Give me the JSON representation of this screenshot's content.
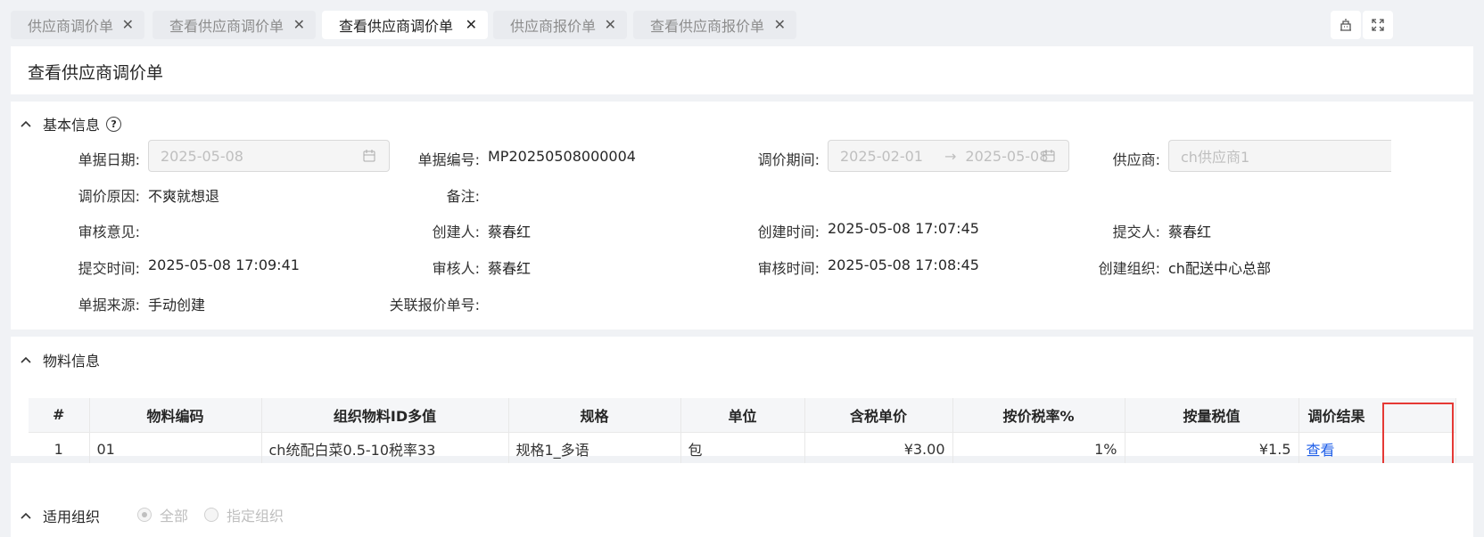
{
  "tabs": [
    {
      "label": "供应商调价单",
      "active": false
    },
    {
      "label": "查看供应商调价单",
      "active": false
    },
    {
      "label": "查看供应商调价单",
      "active": true
    },
    {
      "label": "供应商报价单",
      "active": false
    },
    {
      "label": "查看供应商报价单",
      "active": false
    }
  ],
  "close_glyph": "✕",
  "toolbar_icons": [
    "building-icon",
    "fullscreen-icon"
  ],
  "page_title": "查看供应商调价单",
  "basic": {
    "section_title": "基本信息",
    "doc_date_label": "单据日期:",
    "doc_date_value": "2025-05-08",
    "doc_no_label": "单据编号:",
    "doc_no_value": "MP20250508000004",
    "period_label": "调价期间:",
    "period_start": "2025-02-01",
    "period_end": "2025-05-08",
    "period_arrow": "→",
    "supplier_label": "供应商:",
    "supplier_value": "ch供应商1",
    "reason_label": "调价原因:",
    "reason_value": "不爽就想退",
    "remark_label": "备注:",
    "audit_opinion_label": "审核意见:",
    "creator_label": "创建人:",
    "creator_value": "蔡春红",
    "create_time_label": "创建时间:",
    "create_time_value": "2025-05-08 17:07:45",
    "submitter_label": "提交人:",
    "submitter_value": "蔡春红",
    "submit_time_label": "提交时间:",
    "submit_time_value": "2025-05-08 17:09:41",
    "auditor_label": "审核人:",
    "auditor_value": "蔡春红",
    "audit_time_label": "审核时间:",
    "audit_time_value": "2025-05-08 17:08:45",
    "create_org_label": "创建组织:",
    "create_org_value": "ch配送中心总部",
    "source_label": "单据来源:",
    "source_value": "手动创建",
    "related_quote_label": "关联报价单号:"
  },
  "materials": {
    "section_title": "物料信息",
    "columns": [
      "#",
      "物料编码",
      "组织物料ID多值",
      "规格",
      "单位",
      "含税单价",
      "按价税率%",
      "按量税值",
      "调价结果"
    ],
    "rows": [
      {
        "idx": "1",
        "code": "01",
        "org_material": "ch统配白菜0.5-10税率33",
        "spec": "规格1_多语",
        "unit": "包",
        "price": "¥3.00",
        "rate": "1%",
        "tax": "¥1.5",
        "result": "查看"
      }
    ]
  },
  "org": {
    "section_title": "适用组织",
    "options": [
      "全部",
      "指定组织"
    ],
    "selected": "全部"
  },
  "colors": {
    "accent_link": "#1e5ee8",
    "highlight": "#e53935"
  }
}
